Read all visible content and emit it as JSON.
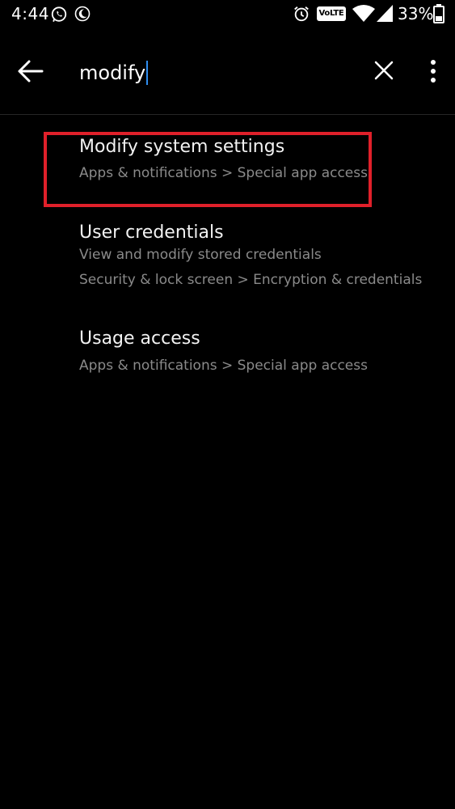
{
  "status_bar": {
    "time": "4:44",
    "volte_label": "VoLTE",
    "battery_percent": "33%"
  },
  "search": {
    "query": "modify"
  },
  "results": [
    {
      "title": "Modify system settings",
      "lines": [
        "Apps & notifications > Special app access"
      ]
    },
    {
      "title": "User credentials",
      "lines": [
        "View and modify stored credentials",
        "Security & lock screen > Encryption & credentials"
      ]
    },
    {
      "title": "Usage access",
      "lines": [
        "Apps & notifications > Special app access"
      ]
    }
  ],
  "colors": {
    "background": "#000000",
    "highlight": "#e0202a",
    "cursor": "#2f8ef0",
    "secondary_text": "#8a8a8a"
  },
  "icons": [
    "whatsapp-icon",
    "moon-icon",
    "alarm-icon",
    "wifi-icon",
    "signal-icon",
    "battery-icon",
    "back-arrow-icon",
    "close-icon",
    "more-vert-icon"
  ]
}
